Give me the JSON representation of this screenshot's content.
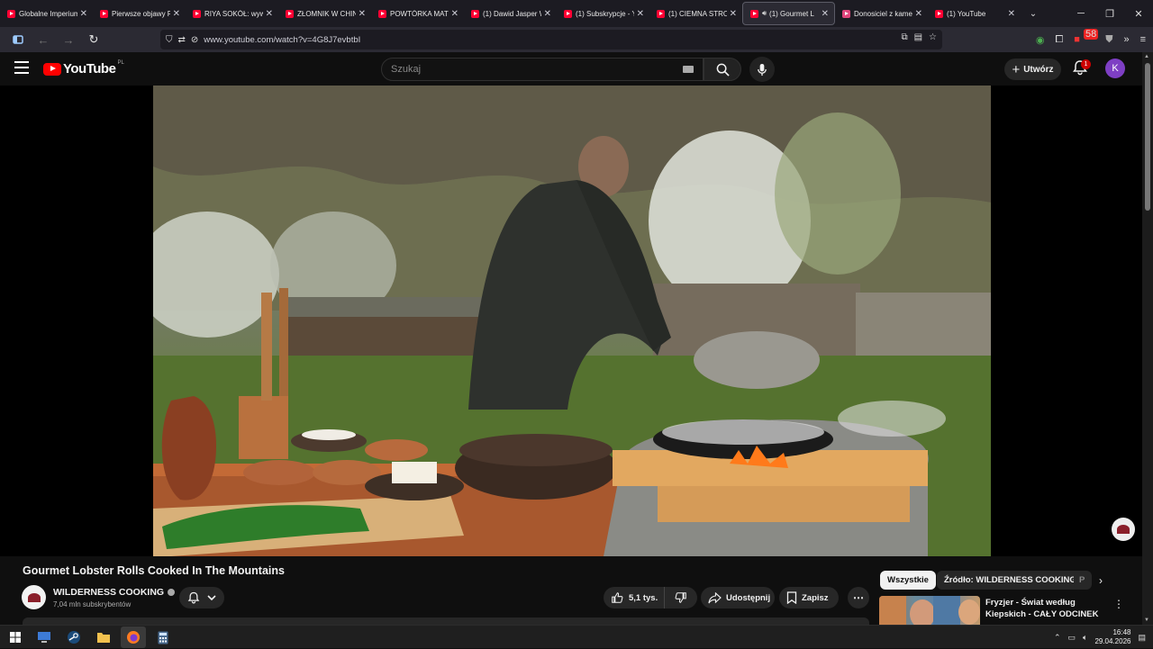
{
  "browser": {
    "tabs": [
      {
        "title": "Globalne Imperium",
        "favicon": "youtube-icon",
        "active": false
      },
      {
        "title": "Pierwsze objawy R",
        "favicon": "youtube-icon",
        "active": false
      },
      {
        "title": "RIYA SOKÓŁ: wywi",
        "favicon": "youtube-icon",
        "active": false
      },
      {
        "title": "ZŁOMNIK W CHIN",
        "favicon": "youtube-icon",
        "active": false
      },
      {
        "title": "POWTÓRKA MATU",
        "favicon": "youtube-icon",
        "active": false
      },
      {
        "title": "(1) Dawid Jasper W",
        "favicon": "youtube-icon",
        "active": false
      },
      {
        "title": "(1) Subskrypcje - Y",
        "favicon": "youtube-icon",
        "active": false
      },
      {
        "title": "(1) CIEMNA STRO",
        "favicon": "youtube-icon",
        "active": false
      },
      {
        "title": "(1) Gourmet L",
        "favicon": "youtube-icon",
        "active": true,
        "audio": true
      },
      {
        "title": "Donosiciel z kame",
        "favicon": "page-icon",
        "active": false
      },
      {
        "title": "(1) YouTube",
        "favicon": "youtube-icon",
        "active": false
      }
    ],
    "url": "www.youtube.com/watch?v=4G8J7evbtbI",
    "extension_badge": "58",
    "accent": "#ff0033"
  },
  "youtube": {
    "logo_text": "YouTube",
    "country_code": "PL",
    "search_placeholder": "Szukaj",
    "create_label": "Utwórz",
    "notification_count": "1",
    "avatar_letter": "K",
    "avatar_color": "#7e3fc4"
  },
  "video": {
    "title": "Gourmet Lobster Rolls Cooked In The Mountains",
    "channel_name": "WILDERNESS COOKING",
    "subscribers": "7,04 mln subskrybentów",
    "likes": "5,1 tys.",
    "share_label": "Udostępnij",
    "save_label": "Zapisz"
  },
  "sidebar": {
    "chips": [
      "Wszystkie",
      "Źródło: WILDERNESS COOKING",
      "P"
    ],
    "recommendation": {
      "title": "Fryzjer - Świat według Kiepskich - CAŁY ODCINEK ..."
    }
  },
  "taskbar": {
    "time": "16:48",
    "date": "29.04.2026"
  }
}
